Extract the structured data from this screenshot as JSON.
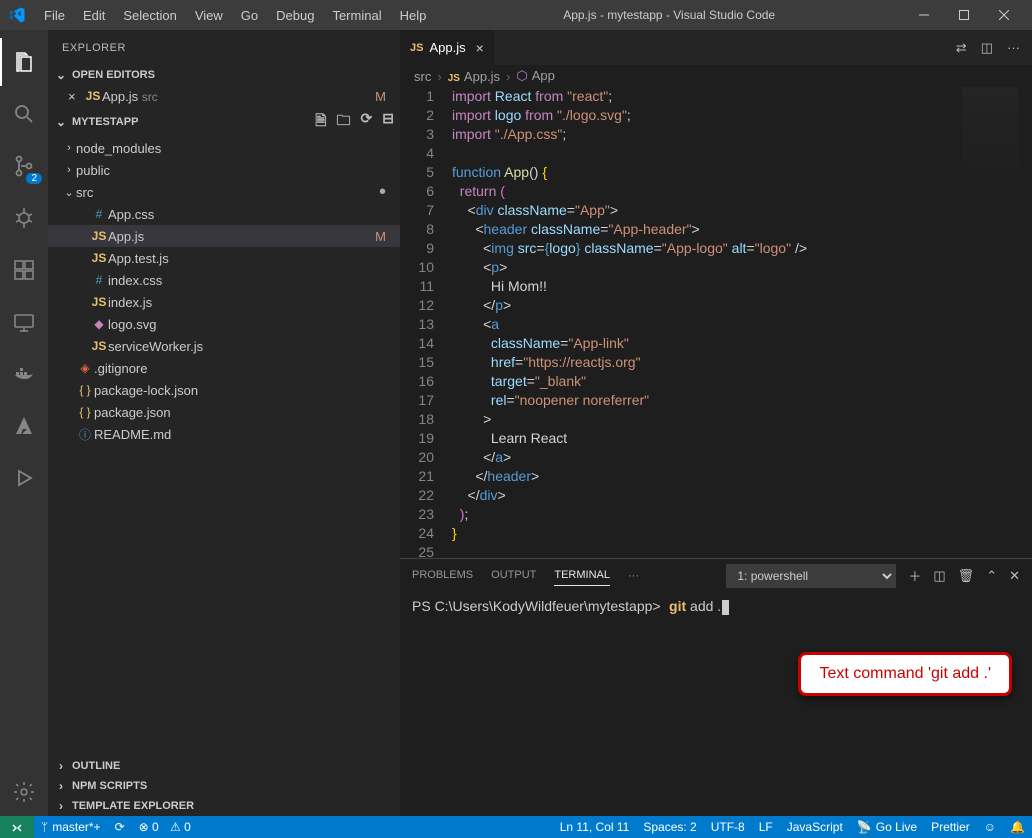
{
  "window": {
    "title": "App.js - mytestapp - Visual Studio Code"
  },
  "menu": [
    "File",
    "Edit",
    "Selection",
    "View",
    "Go",
    "Debug",
    "Terminal",
    "Help"
  ],
  "activitybar": {
    "scm_badge": "2"
  },
  "sidebar": {
    "title": "EXPLORER",
    "open_editors_label": "OPEN EDITORS",
    "open_editors": [
      {
        "name": "App.js",
        "folder": "src",
        "git": "M",
        "icon": "js"
      }
    ],
    "folder_label": "MYTESTAPP",
    "tree": [
      {
        "type": "folder",
        "name": "node_modules",
        "expanded": false,
        "depth": 0
      },
      {
        "type": "folder",
        "name": "public",
        "expanded": false,
        "depth": 0
      },
      {
        "type": "folder",
        "name": "src",
        "expanded": true,
        "depth": 0,
        "dirty": true
      },
      {
        "type": "file",
        "name": "App.css",
        "depth": 1,
        "icon": "css"
      },
      {
        "type": "file",
        "name": "App.js",
        "depth": 1,
        "icon": "js",
        "git": "M",
        "selected": true
      },
      {
        "type": "file",
        "name": "App.test.js",
        "depth": 1,
        "icon": "js"
      },
      {
        "type": "file",
        "name": "index.css",
        "depth": 1,
        "icon": "css"
      },
      {
        "type": "file",
        "name": "index.js",
        "depth": 1,
        "icon": "js"
      },
      {
        "type": "file",
        "name": "logo.svg",
        "depth": 1,
        "icon": "svg"
      },
      {
        "type": "file",
        "name": "serviceWorker.js",
        "depth": 1,
        "icon": "js"
      },
      {
        "type": "file",
        "name": ".gitignore",
        "depth": 0,
        "icon": "git"
      },
      {
        "type": "file",
        "name": "package-lock.json",
        "depth": 0,
        "icon": "json"
      },
      {
        "type": "file",
        "name": "package.json",
        "depth": 0,
        "icon": "json"
      },
      {
        "type": "file",
        "name": "README.md",
        "depth": 0,
        "icon": "md"
      }
    ],
    "collapsed_sections": [
      "OUTLINE",
      "NPM SCRIPTS",
      "TEMPLATE EXPLORER"
    ]
  },
  "tab": {
    "name": "App.js"
  },
  "breadcrumbs": [
    "src",
    "App.js",
    "App"
  ],
  "code_lines": [
    [
      {
        "t": "key",
        "v": "import"
      },
      {
        "t": "p",
        "v": " "
      },
      {
        "t": "def",
        "v": "React"
      },
      {
        "t": "p",
        "v": " "
      },
      {
        "t": "key",
        "v": "from"
      },
      {
        "t": "p",
        "v": " "
      },
      {
        "t": "str",
        "v": "\"react\""
      },
      {
        "t": "p",
        "v": ";"
      }
    ],
    [
      {
        "t": "key",
        "v": "import"
      },
      {
        "t": "p",
        "v": " "
      },
      {
        "t": "def",
        "v": "logo"
      },
      {
        "t": "p",
        "v": " "
      },
      {
        "t": "key",
        "v": "from"
      },
      {
        "t": "p",
        "v": " "
      },
      {
        "t": "str",
        "v": "\"./logo.svg\""
      },
      {
        "t": "p",
        "v": ";"
      }
    ],
    [
      {
        "t": "key",
        "v": "import"
      },
      {
        "t": "p",
        "v": " "
      },
      {
        "t": "str",
        "v": "\"./App.css\""
      },
      {
        "t": "p",
        "v": ";"
      }
    ],
    [],
    [
      {
        "t": "tag",
        "v": "function"
      },
      {
        "t": "p",
        "v": " "
      },
      {
        "t": "fn",
        "v": "App"
      },
      {
        "t": "p",
        "v": "() "
      },
      {
        "t": "brace",
        "v": "{"
      }
    ],
    [
      {
        "t": "p",
        "v": "  "
      },
      {
        "t": "key",
        "v": "return"
      },
      {
        "t": "p",
        "v": " "
      },
      {
        "t": "brace2",
        "v": "("
      }
    ],
    [
      {
        "t": "p",
        "v": "    <"
      },
      {
        "t": "tag",
        "v": "div"
      },
      {
        "t": "p",
        "v": " "
      },
      {
        "t": "attr",
        "v": "className"
      },
      {
        "t": "p",
        "v": "="
      },
      {
        "t": "str",
        "v": "\"App\""
      },
      {
        "t": "p",
        "v": ">"
      }
    ],
    [
      {
        "t": "p",
        "v": "      <"
      },
      {
        "t": "tag",
        "v": "header"
      },
      {
        "t": "p",
        "v": " "
      },
      {
        "t": "attr",
        "v": "className"
      },
      {
        "t": "p",
        "v": "="
      },
      {
        "t": "str",
        "v": "\"App-header\""
      },
      {
        "t": "p",
        "v": ">"
      }
    ],
    [
      {
        "t": "p",
        "v": "        <"
      },
      {
        "t": "tag",
        "v": "img"
      },
      {
        "t": "p",
        "v": " "
      },
      {
        "t": "attr",
        "v": "src"
      },
      {
        "t": "p",
        "v": "="
      },
      {
        "t": "tag",
        "v": "{"
      },
      {
        "t": "def",
        "v": "logo"
      },
      {
        "t": "tag",
        "v": "}"
      },
      {
        "t": "p",
        "v": " "
      },
      {
        "t": "attr",
        "v": "className"
      },
      {
        "t": "p",
        "v": "="
      },
      {
        "t": "str",
        "v": "\"App-logo\""
      },
      {
        "t": "p",
        "v": " "
      },
      {
        "t": "attr",
        "v": "alt"
      },
      {
        "t": "p",
        "v": "="
      },
      {
        "t": "str",
        "v": "\"logo\""
      },
      {
        "t": "p",
        "v": " />"
      }
    ],
    [
      {
        "t": "p",
        "v": "        <"
      },
      {
        "t": "tag",
        "v": "p"
      },
      {
        "t": "p",
        "v": ">"
      }
    ],
    [
      {
        "t": "p",
        "v": "          Hi Mom!!"
      }
    ],
    [
      {
        "t": "p",
        "v": "        </"
      },
      {
        "t": "tag",
        "v": "p"
      },
      {
        "t": "p",
        "v": ">"
      }
    ],
    [
      {
        "t": "p",
        "v": "        <"
      },
      {
        "t": "tag",
        "v": "a"
      }
    ],
    [
      {
        "t": "p",
        "v": "          "
      },
      {
        "t": "attr",
        "v": "className"
      },
      {
        "t": "p",
        "v": "="
      },
      {
        "t": "str",
        "v": "\"App-link\""
      }
    ],
    [
      {
        "t": "p",
        "v": "          "
      },
      {
        "t": "attr",
        "v": "href"
      },
      {
        "t": "p",
        "v": "="
      },
      {
        "t": "str",
        "v": "\"https://reactjs.org\""
      }
    ],
    [
      {
        "t": "p",
        "v": "          "
      },
      {
        "t": "attr",
        "v": "target"
      },
      {
        "t": "p",
        "v": "="
      },
      {
        "t": "str",
        "v": "\"_blank\""
      }
    ],
    [
      {
        "t": "p",
        "v": "          "
      },
      {
        "t": "attr",
        "v": "rel"
      },
      {
        "t": "p",
        "v": "="
      },
      {
        "t": "str",
        "v": "\"noopener noreferrer\""
      }
    ],
    [
      {
        "t": "p",
        "v": "        >"
      }
    ],
    [
      {
        "t": "p",
        "v": "          Learn React"
      }
    ],
    [
      {
        "t": "p",
        "v": "        </"
      },
      {
        "t": "tag",
        "v": "a"
      },
      {
        "t": "p",
        "v": ">"
      }
    ],
    [
      {
        "t": "p",
        "v": "      </"
      },
      {
        "t": "tag",
        "v": "header"
      },
      {
        "t": "p",
        "v": ">"
      }
    ],
    [
      {
        "t": "p",
        "v": "    </"
      },
      {
        "t": "tag",
        "v": "div"
      },
      {
        "t": "p",
        "v": ">"
      }
    ],
    [
      {
        "t": "p",
        "v": "  "
      },
      {
        "t": "brace2",
        "v": ")"
      },
      {
        "t": "p",
        "v": ";"
      }
    ],
    [
      {
        "t": "brace",
        "v": "}"
      }
    ],
    []
  ],
  "panel": {
    "tabs": [
      "PROBLEMS",
      "OUTPUT",
      "TERMINAL"
    ],
    "active_tab": "TERMINAL",
    "terminal_selector": "1: powershell",
    "prompt": "PS C:\\Users\\KodyWildfeuer\\mytestapp>",
    "cmd_part1": "git",
    "cmd_part2": " add ."
  },
  "callout": {
    "text": "Text command 'git add .'"
  },
  "status": {
    "branch": "master*+",
    "sync": "⟳",
    "errors": "⊗ 0",
    "warnings": "⚠ 0",
    "ln_col": "Ln 11, Col 11",
    "spaces": "Spaces: 2",
    "encoding": "UTF-8",
    "eol": "LF",
    "lang": "JavaScript",
    "golive": "Go Live",
    "prettier": "Prettier",
    "feedback": "☺",
    "bell": "🔔"
  }
}
